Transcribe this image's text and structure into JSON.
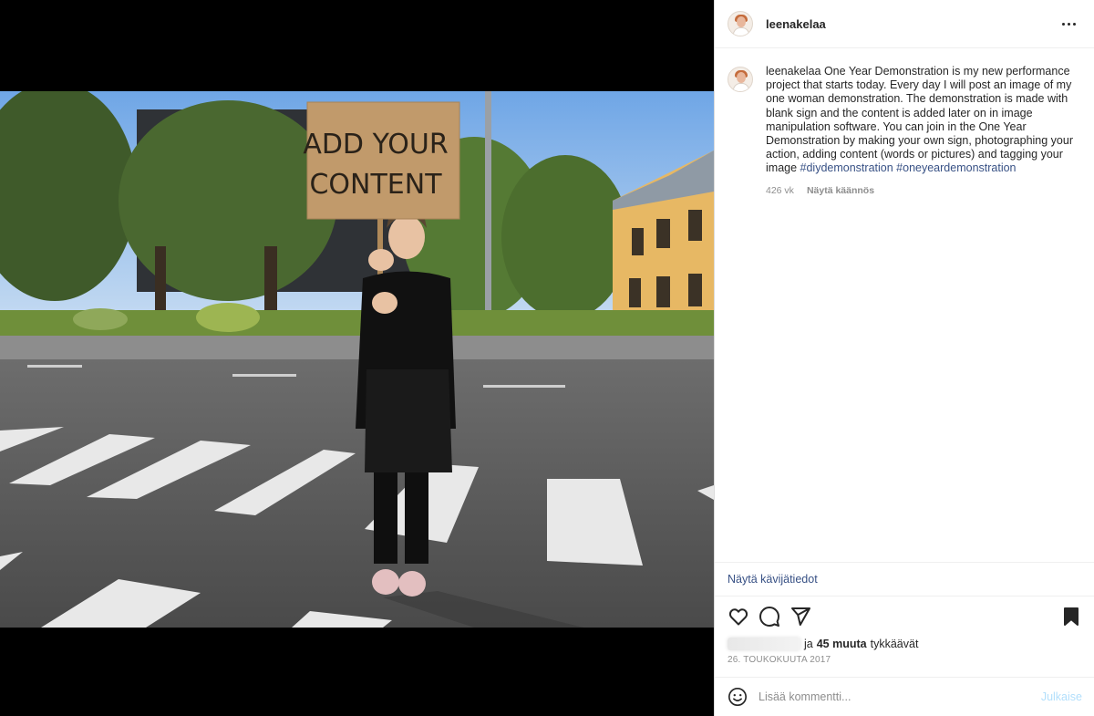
{
  "post": {
    "username": "leenakelaa",
    "caption": {
      "username": "leenakelaa",
      "text": " One Year Demonstration is my new performance project that starts today. Every day I will post an image of my one woman demonstration. The demonstration is made with blank sign and the content is added later on in image manipulation software. You can join in the One Year Demonstration by making your own sign, photographing your action, adding content (words or pictures) and tagging your image ",
      "hashtags": [
        "#diydemonstration",
        "#oneyeardemonstration"
      ],
      "age": "426 vk",
      "translate_label": "Näytä käännös"
    },
    "insights_label": "Näytä kävijätiedot",
    "likes": {
      "prefix": "ja",
      "count_label": "45 muuta",
      "suffix": "tykkäävät"
    },
    "date": "26. TOUKOKUUTA 2017",
    "comment": {
      "placeholder": "Lisää kommentti...",
      "publish_label": "Julkaise"
    },
    "photo": {
      "sign_line1": "ADD YOUR",
      "sign_line2": "CONTENT"
    },
    "colors": {
      "link": "#385185",
      "muted": "#8e8e8e",
      "publish_disabled": "#b2dffc",
      "sign": "#c19a6b"
    },
    "icons": [
      "more-icon",
      "heart-icon",
      "comment-icon",
      "share-icon",
      "bookmark-icon",
      "emoji-icon"
    ]
  }
}
